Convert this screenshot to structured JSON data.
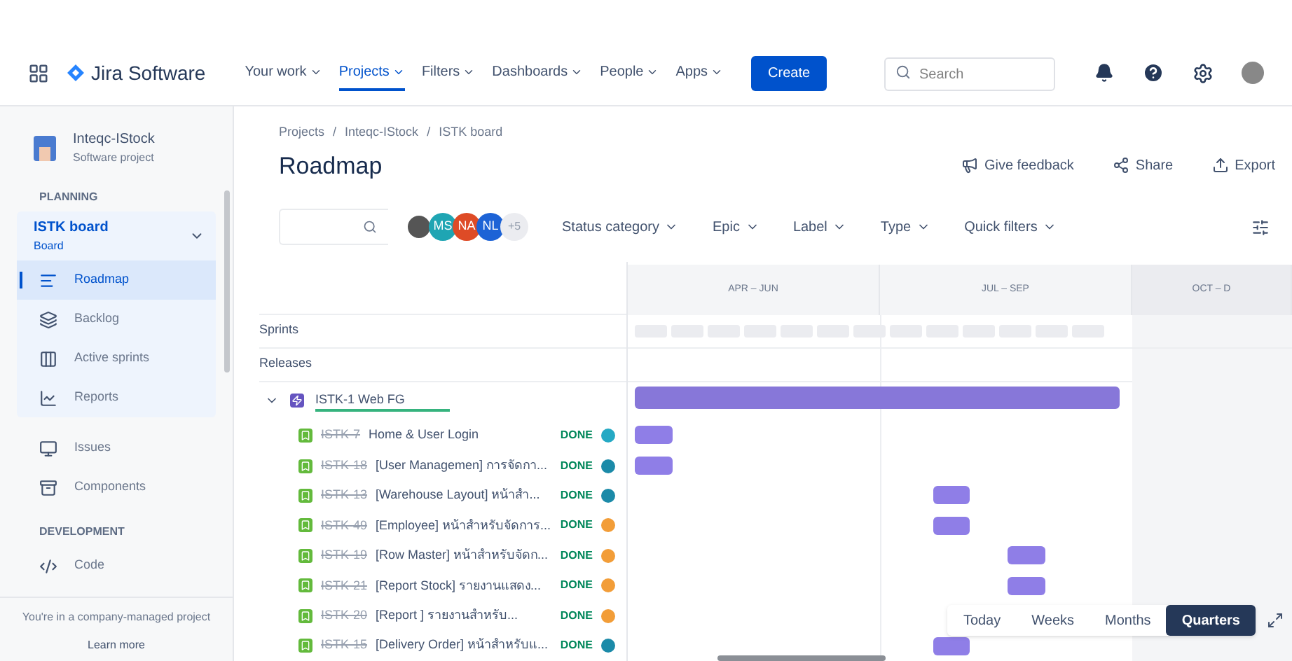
{
  "nav": {
    "product": "Jira Software",
    "items": [
      {
        "label": "Your work",
        "selected": false
      },
      {
        "label": "Projects",
        "selected": true
      },
      {
        "label": "Filters",
        "selected": false
      },
      {
        "label": "Dashboards",
        "selected": false
      },
      {
        "label": "People",
        "selected": false
      },
      {
        "label": "Apps",
        "selected": false
      }
    ],
    "create": "Create",
    "search": {
      "placeholder": "Search"
    }
  },
  "sidebar": {
    "project": "Inteqc-IStock",
    "project_type": "Software project",
    "sections": [
      {
        "heading": "PLANNING",
        "board": {
          "name": "ISTK board",
          "type": "Board"
        },
        "items": [
          {
            "label": "Roadmap",
            "selected": true
          },
          {
            "label": "Backlog",
            "selected": false
          },
          {
            "label": "Active sprints",
            "selected": false
          },
          {
            "label": "Reports",
            "selected": false
          }
        ]
      },
      {
        "items": [
          {
            "label": "Issues",
            "selected": false
          },
          {
            "label": "Components",
            "selected": false
          }
        ]
      },
      {
        "heading": "DEVELOPMENT",
        "items": [
          {
            "label": "Code",
            "selected": false
          }
        ]
      }
    ],
    "footer": "You're in a company-managed project",
    "footer_link": "Learn more"
  },
  "breadcrumbs": [
    "Projects",
    "Inteqc-IStock",
    "ISTK board"
  ],
  "breadcrumb_separator": "/",
  "title": "Roadmap",
  "actions": [
    {
      "label": "Give feedback"
    },
    {
      "label": "Share"
    },
    {
      "label": "Export"
    }
  ],
  "avatars": [
    {
      "kind": "photo"
    },
    {
      "kind": "initials",
      "text": "MS",
      "color": "#1fa5b3"
    },
    {
      "kind": "initials",
      "text": "NA",
      "color": "#de4b26"
    },
    {
      "kind": "initials",
      "text": "NL",
      "color": "#1d63d6"
    },
    {
      "kind": "more",
      "text": "+5"
    }
  ],
  "filters": [
    "Status category",
    "Epic",
    "Label",
    "Type",
    "Quick filters"
  ],
  "timeline": {
    "quarters": [
      "APR – JUN",
      "JUL – SEP",
      "OCT – D"
    ],
    "rows_header": [
      "Sprints",
      "Releases"
    ]
  },
  "epic": {
    "key": "ISTK-1",
    "title": "Web FG",
    "expanded": true,
    "issues": [
      {
        "key": "ISTK-7",
        "title": "Home & User Login",
        "status": "DONE",
        "color": "#25a9c4"
      },
      {
        "key": "ISTK-18",
        "title": "[User Managemen] การจัดกา...",
        "status": "DONE",
        "color": "#1b8aa8"
      },
      {
        "key": "ISTK-13",
        "title": "[Warehouse Layout] หน้าสำ...",
        "status": "DONE",
        "color": "#1b8aa8"
      },
      {
        "key": "ISTK-49",
        "title": "[Employee] หน้าสำหรับจัดการ...",
        "status": "DONE",
        "color": "#f29d38"
      },
      {
        "key": "ISTK-19",
        "title": "[Row Master] หน้าสำหรับจัดก...",
        "status": "DONE",
        "color": "#f29d38"
      },
      {
        "key": "ISTK-21",
        "title": "[Report Stock] รายงานแสดง...",
        "status": "DONE",
        "color": "#f29d38"
      },
      {
        "key": "ISTK-20",
        "title": "[Report ] รายงานสำหรับ...",
        "status": "DONE",
        "color": "#f29d38"
      },
      {
        "key": "ISTK-15",
        "title": "[Delivery Order] หน้าสำหรับแ...",
        "status": "DONE",
        "color": "#1b8aa8"
      }
    ]
  },
  "zoom": [
    {
      "label": "Today",
      "selected": false
    },
    {
      "label": "Weeks",
      "selected": false
    },
    {
      "label": "Months",
      "selected": false
    },
    {
      "label": "Quarters",
      "selected": true
    }
  ]
}
